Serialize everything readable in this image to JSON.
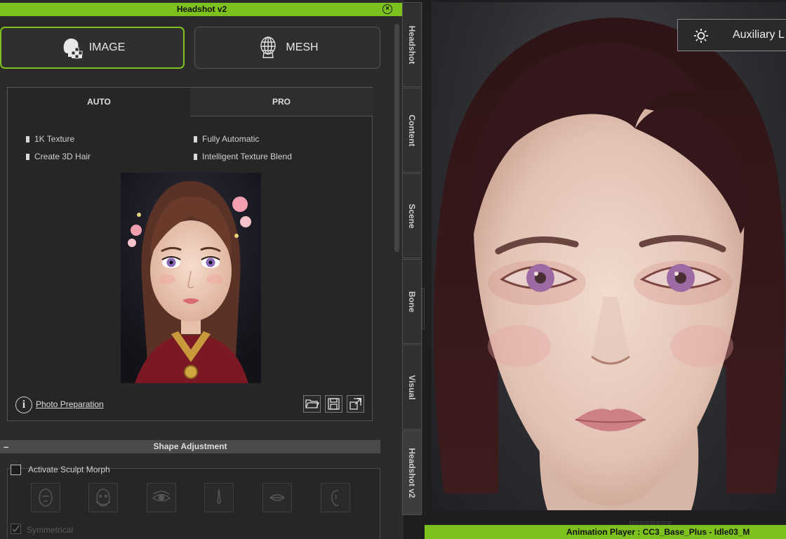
{
  "window": {
    "title": "Headshot v2"
  },
  "mode_buttons": {
    "image_label": "IMAGE",
    "mesh_label": "MESH"
  },
  "tabs": {
    "auto_label": "AUTO",
    "pro_label": "PRO"
  },
  "features": [
    "1K Texture",
    "Fully Automatic",
    "Create 3D Hair",
    "Intelligent Texture Blend"
  ],
  "photo": {
    "link_label": "Photo Preparation"
  },
  "shape_adjustment": {
    "section_title": "Shape Adjustment",
    "activate_label": "Activate Sculpt Morph",
    "activate_checked": false,
    "symmetrical_label": "Symmetrical",
    "symmetrical_checked": true,
    "morph_icons": [
      "head-morph-icon",
      "face-morph-icon",
      "eye-morph-icon",
      "nose-morph-icon",
      "mouth-morph-icon",
      "ear-morph-icon"
    ]
  },
  "side_tabs": [
    "Headshot",
    "Content",
    "Scene",
    "Bone",
    "Visual",
    "Headshot v2"
  ],
  "active_side_tab": "Headshot v2",
  "viewport": {
    "auxiliary_label": "Auxiliary L"
  },
  "status": {
    "animation_player": "Animation Player : CC3_Base_Plus - Idle03_M"
  },
  "colors": {
    "accent": "#7cc11d",
    "panel_bg": "#2b2b2b",
    "viewport_bg": "#2d2e31"
  }
}
